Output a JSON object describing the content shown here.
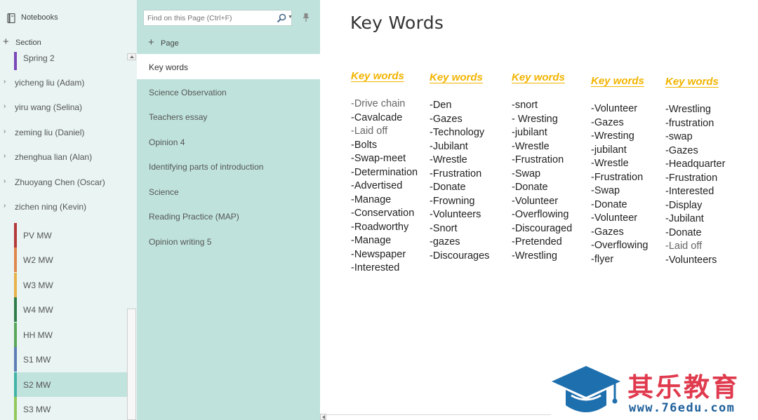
{
  "navigation": {
    "notebooks_label": "Notebooks",
    "add_section_label": "Section",
    "current_section": "Spring 2",
    "notebooks": [
      {
        "label": "yicheng liu (Adam)"
      },
      {
        "label": "yiru wang (Selina)"
      },
      {
        "label": "zeming liu (Daniel)"
      },
      {
        "label": "zhenghua lian (Alan)"
      },
      {
        "label": "Zhuoyang Chen (Oscar)"
      },
      {
        "label": "zichen ning (Kevin)"
      }
    ],
    "sections": [
      {
        "label": "PV MW",
        "color": "#b43a3a"
      },
      {
        "label": "W2 MW",
        "color": "#e0874b"
      },
      {
        "label": "W3 MW",
        "color": "#e8b24a"
      },
      {
        "label": "W4 MW",
        "color": "#2f7d4a"
      },
      {
        "label": "HH MW",
        "color": "#5aa65a"
      },
      {
        "label": "S1 MW",
        "color": "#5d7fb5"
      },
      {
        "label": "S2 MW",
        "color": "#43b3a6",
        "selected": true
      },
      {
        "label": "S3 MW",
        "color": "#93c95a"
      }
    ]
  },
  "page_list": {
    "search_placeholder": "Find on this Page (Ctrl+F)",
    "add_page_label": "Page",
    "pages": [
      {
        "label": "Key words",
        "active": true
      },
      {
        "label": "Science Observation"
      },
      {
        "label": "Teachers essay"
      },
      {
        "label": "Opinion 4"
      },
      {
        "label": "Identifying parts of introduction"
      },
      {
        "label": "Science"
      },
      {
        "label": "Reading Practice (MAP)"
      },
      {
        "label": "Opinion writing 5"
      }
    ]
  },
  "canvas": {
    "title": "Key Words",
    "columns": [
      {
        "heading": "Key words",
        "items": [
          "-Drive chain",
          "-Cavalcade",
          "-Laid off",
          "-Bolts",
          "-Swap-meet",
          "-Determination",
          "-Advertised",
          "-Manage",
          "-Conservation",
          "-Roadworthy",
          "-Manage",
          "-Newspaper",
          "-Interested"
        ]
      },
      {
        "heading": "Key words",
        "items": [
          "-Den",
          "-Gazes",
          "-Technology",
          "-Jubilant",
          "-Wrestle",
          "-Frustration",
          "-Donate",
          "-Frowning",
          "-Volunteers",
          "-Snort",
          "-gazes",
          "-Discourages"
        ]
      },
      {
        "heading": "Key words",
        "items": [
          "-snort",
          "- Wresting",
          "-jubilant",
          "-Wrestle",
          "-Frustration",
          "-Swap",
          "-Donate",
          "-Volunteer",
          "-Overflowing",
          "-Discouraged",
          "-Pretended",
          "-Wrestling"
        ]
      },
      {
        "heading": "Key words",
        "items": [
          "-Volunteer",
          "-Gazes",
          "-Wresting",
          "-jubilant",
          "-Wrestle",
          "-Frustration",
          "-Swap",
          "-Donate",
          "-Volunteer",
          "-Gazes",
          "-Overflowing",
          "-flyer"
        ]
      },
      {
        "heading": "Key words",
        "items": [
          "-Wrestling",
          "-frustration",
          "-swap",
          "-Gazes",
          "-Headquarter",
          "-Frustration",
          "-Interested",
          "-Display",
          "-Jubilant",
          "-Donate",
          "-Laid off",
          "-Volunteers"
        ]
      }
    ]
  },
  "watermark": {
    "title": "其乐教育",
    "url": "www.76edu.com"
  }
}
